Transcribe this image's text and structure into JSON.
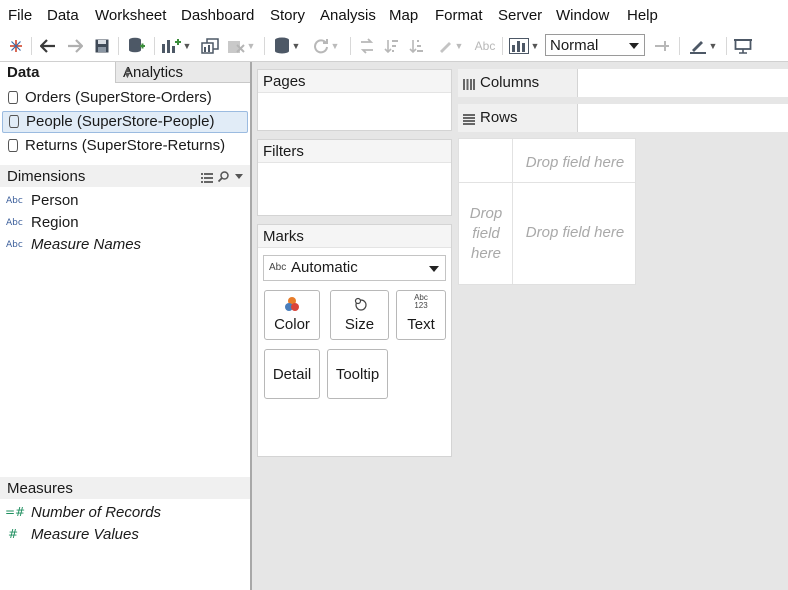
{
  "menu": [
    "File",
    "Data",
    "Worksheet",
    "Dashboard",
    "Story",
    "Analysis",
    "Map",
    "Format",
    "Server",
    "Window",
    "Help"
  ],
  "toolbar": {
    "fit_value": "Normal"
  },
  "left_pane": {
    "tabs": {
      "data": "Data",
      "analytics": "Analytics"
    },
    "data_sources": [
      {
        "label": "Orders (SuperStore-Orders)",
        "selected": false
      },
      {
        "label": "People (SuperStore-People)",
        "selected": true
      },
      {
        "label": "Returns (SuperStore-Returns)",
        "selected": false
      }
    ],
    "dimensions_header": "Dimensions",
    "dimensions": [
      {
        "type": "Abc",
        "label": "Person"
      },
      {
        "type": "Abc",
        "label": "Region"
      },
      {
        "type": "Abc",
        "label": "Measure Names"
      }
    ],
    "measures_header": "Measures",
    "measures": [
      {
        "type": "=#",
        "label": "Number of Records"
      },
      {
        "type": "#",
        "label": "Measure Values"
      }
    ]
  },
  "cards": {
    "pages": "Pages",
    "filters": "Filters",
    "marks": "Marks",
    "mark_type_icon": "Abc",
    "mark_type": "Automatic",
    "buttons": {
      "color": "Color",
      "size": "Size",
      "text": "Text",
      "text_icon_top": "Abc",
      "text_icon_bottom": "123",
      "detail": "Detail",
      "tooltip": "Tooltip"
    }
  },
  "shelves": {
    "columns": "Columns",
    "rows": "Rows"
  },
  "view": {
    "drop_top": "Drop field here",
    "drop_left_1": "Drop",
    "drop_left_2": "field",
    "drop_left_3": "here",
    "drop_center": "Drop field here"
  }
}
